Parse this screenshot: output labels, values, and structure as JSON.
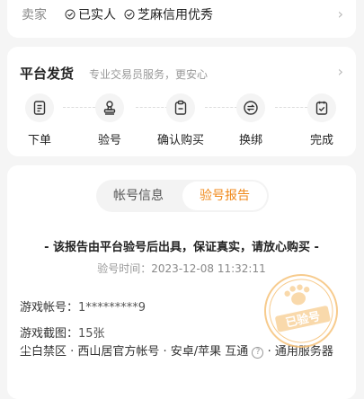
{
  "seller": {
    "label": "卖家",
    "badges": [
      "已实人",
      "芝麻信用优秀"
    ]
  },
  "platform": {
    "title": "平台发货",
    "subtitle": "专业交易员服务，更安心",
    "steps": [
      {
        "label": "下单",
        "icon": "order-icon"
      },
      {
        "label": "验号",
        "icon": "verify-stamp-icon"
      },
      {
        "label": "确认购买",
        "icon": "clipboard-icon"
      },
      {
        "label": "换绑",
        "icon": "swap-icon"
      },
      {
        "label": "完成",
        "icon": "done-icon"
      }
    ]
  },
  "report": {
    "tabs": [
      "帐号信息",
      "验号报告"
    ],
    "active_tab": "验号报告",
    "note": "- 该报告由平台验号后出具，保证真实，请放心购买 -",
    "time_label": "验号时间：",
    "time_value": "2023-12-08 11:32:11",
    "account_key": "游戏帐号：",
    "account_value": "1*********9",
    "shots_key": "游戏截图：",
    "shots_value": "15张",
    "desc_part1": "尘白禁区 · 西山居官方帐号 · 安卓/苹果 互通",
    "desc_part2": "· 通用服务器",
    "stamp_text": "已验号"
  },
  "colors": {
    "accent": "#f08a1c",
    "stamp": "#f6c27a"
  }
}
